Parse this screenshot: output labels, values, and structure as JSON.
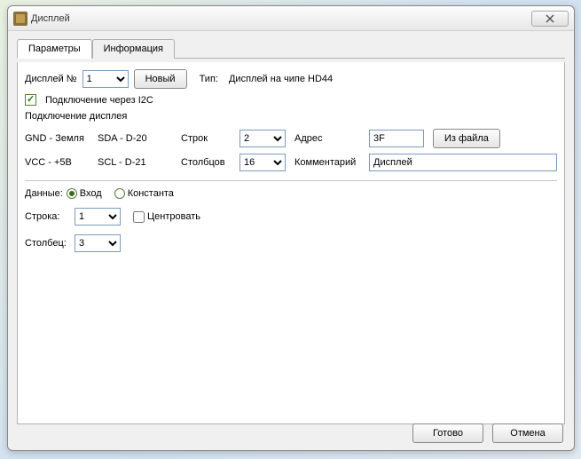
{
  "window": {
    "title": "Дисплей"
  },
  "tabs": {
    "params": "Параметры",
    "info": "Информация"
  },
  "top": {
    "display_no_label": "Дисплей №",
    "display_no": "1",
    "new_btn": "Новый",
    "type_label": "Тип:",
    "type_value": "Дисплей на чипе HD44",
    "i2c_label": "Подключение через I2C",
    "i2c_checked": true
  },
  "conn": {
    "title": "Подключение дисплея",
    "gnd_label": "GND - Земля",
    "sda_label": "SDA - D-20",
    "rows_label": "Строк",
    "rows": "2",
    "addr_label": "Адрес",
    "addr": "3F",
    "file_btn": "Из файла",
    "vcc_label": "VCC - +5B",
    "scl_label": "SCL - D-21",
    "cols_label": "Столбцов",
    "cols": "16",
    "comment_label": "Комментарий",
    "comment": "Дисплей"
  },
  "data_sect": {
    "label": "Данные:",
    "input": "Вход",
    "constant": "Константа",
    "row_label": "Строка:",
    "row": "1",
    "center_label": "Центровать",
    "col_label": "Столбец:",
    "col": "3"
  },
  "footer": {
    "ok": "Готово",
    "cancel": "Отмена"
  }
}
